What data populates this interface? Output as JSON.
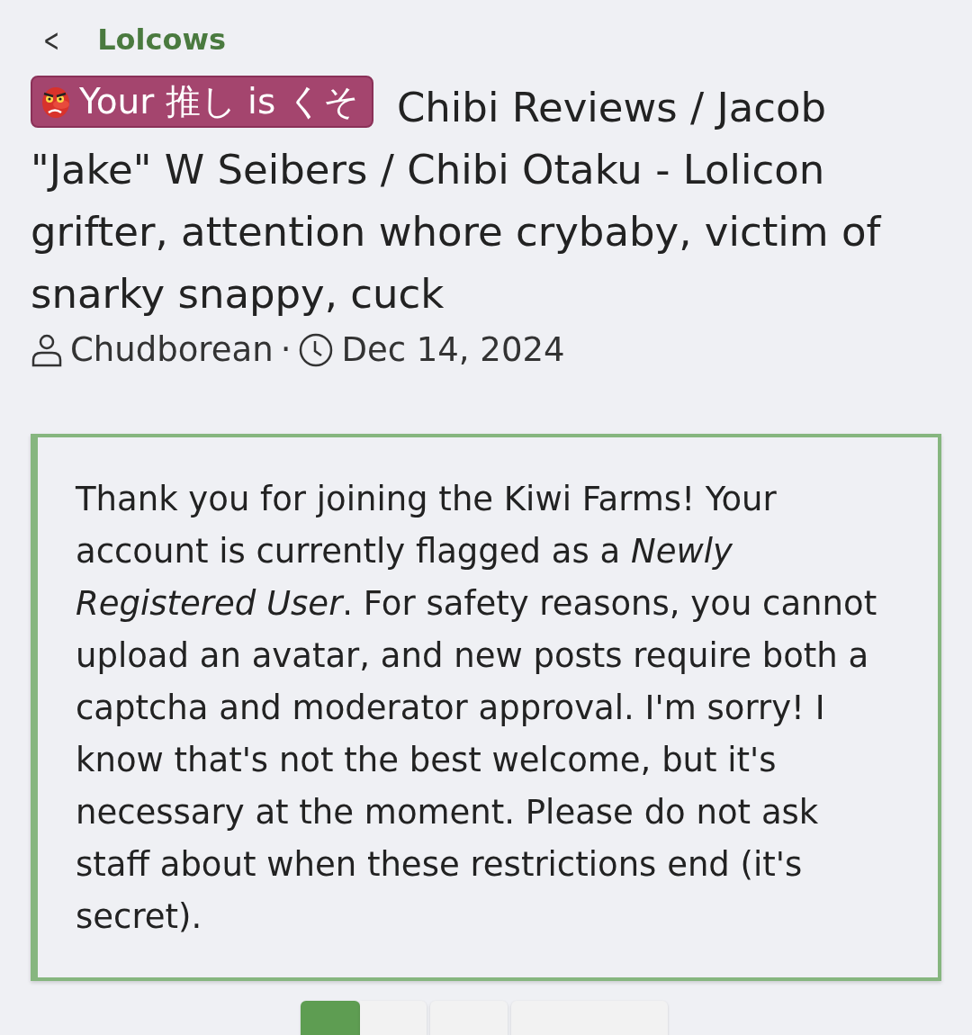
{
  "breadcrumb": {
    "back": "<",
    "label": "Lolcows"
  },
  "thread": {
    "prefix": "Your 推し is くそ",
    "title": "Chibi Reviews / Jacob \"Jake\" W Seibers / Chibi Otaku - Lolicon grifter, attention whore crybaby, victim of snarky snappy, cuck",
    "author": "Chudborean",
    "separator": "·",
    "date": "Dec 14, 2024"
  },
  "notice": {
    "text": "Thank you for joining the Kiwi Farms! Your account is currently flagged as a *Newly Registered User*. For safety reasons, you cannot upload an avatar, and new posts require both a captcha and moderator approval. I'm sorry! I know that's not the best welcome, but it's necessary at the moment. Please do not ask staff about when these restrictions end (it's secret)."
  },
  "pagination": [
    {
      "selected": true
    },
    {
      "selected": false
    },
    {
      "selected": false
    },
    {
      "selected": false
    }
  ]
}
